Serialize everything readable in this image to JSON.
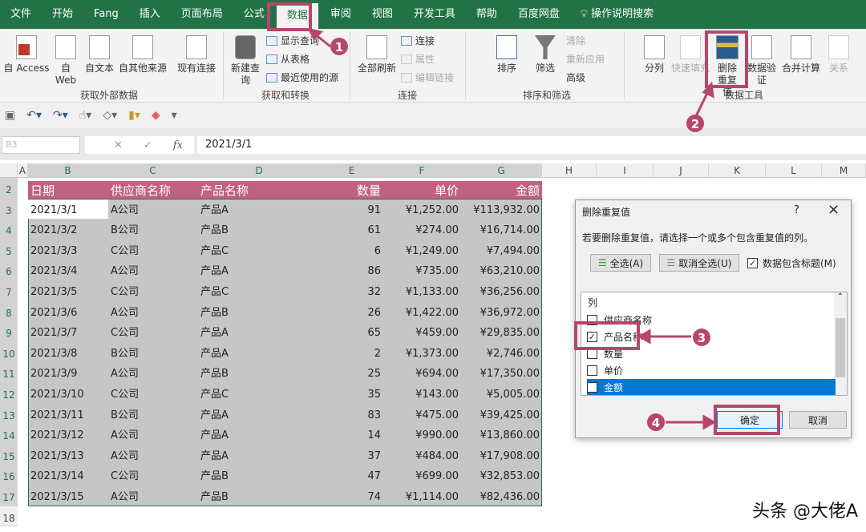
{
  "tabs": [
    "文件",
    "开始",
    "Fang",
    "插入",
    "页面布局",
    "公式",
    "数据",
    "审阅",
    "视图",
    "开发工具",
    "帮助",
    "百度网盘"
  ],
  "active_tab": "数据",
  "tell_me": "操作说明搜索",
  "ribbon": {
    "get_external": {
      "label": "获取外部数据",
      "items": [
        "自 Access",
        "自 Web",
        "自文本",
        "自其他来源",
        "现有连接"
      ]
    },
    "get_transform": {
      "label": "获取和转换",
      "new_query": "新建查询",
      "show_queries": "显示查询",
      "from_table": "从表格",
      "recent_sources": "最近使用的源"
    },
    "connections": {
      "label": "连接",
      "refresh_all": "全部刷新",
      "connections": "连接",
      "properties": "属性",
      "edit_links": "编辑链接"
    },
    "sort_filter": {
      "label": "排序和筛选",
      "sort": "排序",
      "filter": "筛选",
      "clear": "清除",
      "reapply": "重新应用",
      "advanced": "高级"
    },
    "data_tools": {
      "label": "数据工具",
      "text_to_columns": "分列",
      "flash_fill": "快速填充",
      "remove_duplicates": "删除重复值",
      "data_validation": "数据验证",
      "consolidate": "合并计算",
      "relationships": "关系"
    }
  },
  "name_box": "B3",
  "formula": "2021/3/1",
  "columns": [
    "A",
    "B",
    "C",
    "D",
    "E",
    "F",
    "G",
    "H",
    "I",
    "J",
    "K",
    "L",
    "M"
  ],
  "headers": [
    "日期",
    "供应商名称",
    "产品名称",
    "数量",
    "单价",
    "金额"
  ],
  "header_color": "#c0617d",
  "rows": [
    [
      "2021/3/1",
      "A公司",
      "产品A",
      "91",
      "¥1,252.00",
      "¥113,932.00"
    ],
    [
      "2021/3/2",
      "B公司",
      "产品B",
      "61",
      "¥274.00",
      "¥16,714.00"
    ],
    [
      "2021/3/3",
      "C公司",
      "产品C",
      "6",
      "¥1,249.00",
      "¥7,494.00"
    ],
    [
      "2021/3/4",
      "A公司",
      "产品A",
      "86",
      "¥735.00",
      "¥63,210.00"
    ],
    [
      "2021/3/5",
      "C公司",
      "产品C",
      "32",
      "¥1,133.00",
      "¥36,256.00"
    ],
    [
      "2021/3/6",
      "A公司",
      "产品B",
      "26",
      "¥1,422.00",
      "¥36,972.00"
    ],
    [
      "2021/3/7",
      "C公司",
      "产品A",
      "65",
      "¥459.00",
      "¥29,835.00"
    ],
    [
      "2021/3/8",
      "B公司",
      "产品A",
      "2",
      "¥1,373.00",
      "¥2,746.00"
    ],
    [
      "2021/3/9",
      "A公司",
      "产品B",
      "25",
      "¥694.00",
      "¥17,350.00"
    ],
    [
      "2021/3/10",
      "C公司",
      "产品C",
      "35",
      "¥143.00",
      "¥5,005.00"
    ],
    [
      "2021/3/11",
      "B公司",
      "产品A",
      "83",
      "¥475.00",
      "¥39,425.00"
    ],
    [
      "2021/3/12",
      "A公司",
      "产品A",
      "14",
      "¥990.00",
      "¥13,860.00"
    ],
    [
      "2021/3/13",
      "A公司",
      "产品A",
      "37",
      "¥484.00",
      "¥17,908.00"
    ],
    [
      "2021/3/14",
      "C公司",
      "产品B",
      "47",
      "¥699.00",
      "¥32,853.00"
    ],
    [
      "2021/3/15",
      "A公司",
      "产品B",
      "74",
      "¥1,114.00",
      "¥82,436.00"
    ]
  ],
  "dialog": {
    "title": "删除重复值",
    "help": "?",
    "close": "×",
    "instruction": "若要删除重复值，请选择一个或多个包含重复值的列。",
    "select_all": "全选(A)",
    "unselect_all": "取消全选(U)",
    "has_headers": "数据包含标题(M)",
    "has_headers_checked": true,
    "list_header": "列",
    "items": [
      {
        "label": "供应商名称",
        "checked": false
      },
      {
        "label": "产品名称",
        "checked": true
      },
      {
        "label": "数量",
        "checked": false
      },
      {
        "label": "单价",
        "checked": false
      },
      {
        "label": "金额",
        "checked": false,
        "selected": true
      }
    ],
    "ok": "确定",
    "cancel": "取消"
  },
  "annotations": [
    "1",
    "2",
    "3",
    "4"
  ],
  "annotation_color": "#b5476b",
  "watermark": "头条 @大佬A"
}
